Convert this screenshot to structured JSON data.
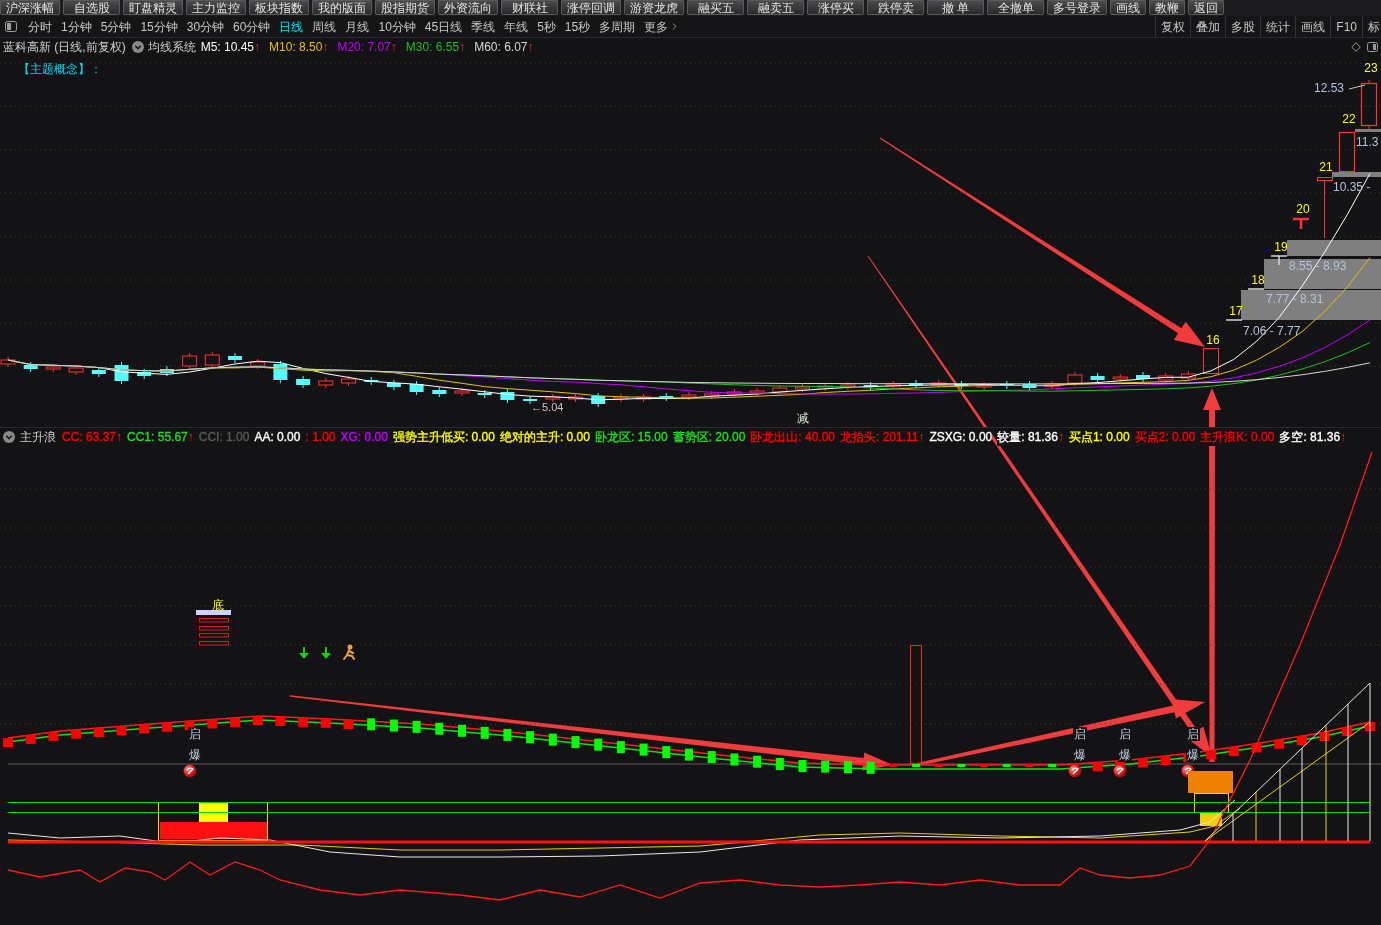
{
  "toolbar": {
    "buttons": [
      "沪深涨幅",
      "自选股",
      "盯盘精灵",
      "主力监控",
      "板块指数",
      "我的版面",
      "股指期货",
      "外资流向",
      "财联社",
      "涨停回调",
      "游资龙虎",
      "融买五",
      "融卖五",
      "涨停买",
      "跌停卖",
      "撤 单",
      "全撤单",
      "多号登录",
      "画线",
      "教鞭",
      "返回"
    ]
  },
  "period_bar": {
    "periods": [
      {
        "label": "分时",
        "selected": false
      },
      {
        "label": "1分钟",
        "selected": false
      },
      {
        "label": "5分钟",
        "selected": false
      },
      {
        "label": "15分钟",
        "selected": false
      },
      {
        "label": "30分钟",
        "selected": false
      },
      {
        "label": "60分钟",
        "selected": false
      },
      {
        "label": "日线",
        "selected": true
      },
      {
        "label": "周线",
        "selected": false
      },
      {
        "label": "月线",
        "selected": false
      },
      {
        "label": "10分钟",
        "selected": false
      },
      {
        "label": "45日线",
        "selected": false
      },
      {
        "label": "季线",
        "selected": false
      },
      {
        "label": "年线",
        "selected": false
      },
      {
        "label": "5秒",
        "selected": false
      },
      {
        "label": "15秒",
        "selected": false
      },
      {
        "label": "多周期",
        "selected": false
      }
    ],
    "more": "更多",
    "tools": [
      "复权",
      "叠加",
      "多股",
      "统计",
      "画线",
      "F10",
      "标"
    ]
  },
  "header": {
    "title": "蓝科高新 (日线,前复权)",
    "system": "均线系统",
    "averages": [
      {
        "text": "M5: 10.45",
        "color": "#ffffff",
        "arrow": "↑"
      },
      {
        "text": "M10: 8.50",
        "color": "#e6c200",
        "arrow": "↑"
      },
      {
        "text": "M20: 7.07",
        "color": "#c400ff",
        "arrow": "↑"
      },
      {
        "text": "M30: 6.55",
        "color": "#1fbf1f",
        "arrow": "↑"
      },
      {
        "text": "M60: 6.07",
        "color": "#d6d6d6",
        "arrow": "↑"
      }
    ]
  },
  "main_chart": {
    "theme_label": "【主题概念】：",
    "day_labels": [
      "16",
      "17",
      "18",
      "19",
      "20",
      "21",
      "22",
      "23"
    ],
    "high_label": "12.53",
    "price_ranges": [
      "11.3",
      "10.35 -",
      "8.55 - 8.93",
      "7.77 - 8.31",
      "7.06 - 7.77"
    ],
    "low_label": "←5.04",
    "reduce_mark": "减"
  },
  "indicator_bar": {
    "title": "主升浪",
    "items": [
      {
        "text": "CC: 63.37",
        "color": "#ff0000",
        "arrow": "↑"
      },
      {
        "text": "CC1: 55.67",
        "color": "#22dd22",
        "arrow": "↑"
      },
      {
        "text": "CCI: 1.00",
        "color": "#5a5a5a"
      },
      {
        "text": "AA: 0.00",
        "color": "#ffffff"
      },
      {
        "text": ": 1.00",
        "color": "#ff0000"
      },
      {
        "text": "XG: 0.00",
        "color": "#c400ff"
      },
      {
        "text": "强势主升低买: 0.00",
        "color": "#ffff00"
      },
      {
        "text": "绝对的主升: 0.00",
        "color": "#ffff00"
      },
      {
        "text": "卧龙区: 15.00",
        "color": "#22dd22"
      },
      {
        "text": "蓄势区: 20.00",
        "color": "#22dd22"
      },
      {
        "text": "卧龙出山: 40.00",
        "color": "#ff0000"
      },
      {
        "text": "龙抬头: 201.11",
        "color": "#ff0000",
        "arrow": "↑"
      },
      {
        "text": "ZSXG: 0.00",
        "color": "#ffffff"
      },
      {
        "text": "较量: 81.36",
        "color": "#ffffff",
        "arrow": "↑"
      },
      {
        "text": "买点1: 0.00",
        "color": "#ffff00"
      },
      {
        "text": "买点2: 0.00",
        "color": "#ff0000"
      },
      {
        "text": "主升浪K: 0.00",
        "color": "#ff0000"
      },
      {
        "text": "多空: 81.36",
        "color": "#ffffff",
        "arrow": "↑"
      }
    ]
  },
  "lower_chart": {
    "bottom_mark": "底",
    "signals": [
      {
        "top": "启",
        "bottom": "爆"
      },
      {
        "top": "启",
        "bottom": "爆"
      },
      {
        "top": "启",
        "bottom": "爆"
      },
      {
        "top": "启",
        "bottom": "爆"
      }
    ]
  }
}
